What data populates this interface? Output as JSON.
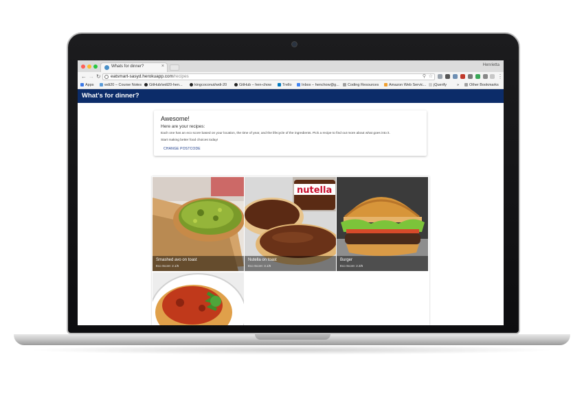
{
  "browser": {
    "tab_title": "Whats for dinner?",
    "tab_close": "×",
    "profile": "Henrietta",
    "url_host": "eatsmart-sasyd.herokuapp.com",
    "url_path": "/recipes",
    "bookmarks": [
      {
        "label": "Apps",
        "color": "#3b78e7"
      },
      {
        "label": "wdi20 – Course Notes",
        "color": "#5a9bd8"
      },
      {
        "label": "GitHub/wdi20-hen...",
        "color": "#222222"
      },
      {
        "label": "kingcoconut/wdi-20",
        "color": "#222222"
      },
      {
        "label": "GitHub – hen-chow",
        "color": "#222222"
      },
      {
        "label": "Trello",
        "color": "#0079bf"
      },
      {
        "label": "Inbox – henchow@g...",
        "color": "#4285f4"
      },
      {
        "label": "Coding Resources",
        "color": "#a0a0a0"
      },
      {
        "label": "Amazon Web Servic...",
        "color": "#f0a030"
      },
      {
        "label": "jQuerify",
        "color": "#cccccc"
      },
      {
        "label": "Other Bookmarks",
        "color": "#a0a0a0"
      }
    ],
    "bookmarks_more": "»"
  },
  "app": {
    "title": "What's for dinner?",
    "brand_color": "#0c2c69"
  },
  "card": {
    "title": "Awesome!",
    "subtitle": "Here are your recipes:",
    "body": "Each one has an eco score based on your location, the time of year, and the lifecycle of the ingredients. Pick a recipe to find out more about what goes into it.",
    "body2": "Start making better food choices today!",
    "action": "CHANGE POSTCODE"
  },
  "recipes": [
    {
      "title": "Smashed avo on toast",
      "score": "Eco Score: 2.1/5"
    },
    {
      "title": "Nutella on toast",
      "score": "Eco Score: 3.1/5"
    },
    {
      "title": "Burger",
      "score": "Eco Score: 2.3/5"
    }
  ]
}
